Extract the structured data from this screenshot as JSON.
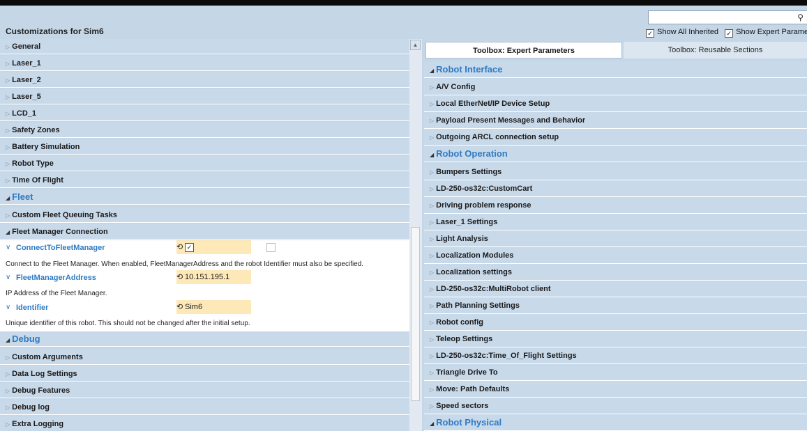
{
  "header": {
    "title": "Customizations for Sim6",
    "search_placeholder": "",
    "show_all_inherited": "Show All Inherited",
    "show_expert": "Show Expert Paramet"
  },
  "left": {
    "top_items": [
      "General",
      "Laser_1",
      "Laser_2",
      "Laser_5",
      "LCD_1",
      "Safety Zones",
      "Battery Simulation",
      "Robot Type",
      "Time Of Flight"
    ],
    "fleet_section": "Fleet",
    "fleet_items": [
      "Custom Fleet Queuing Tasks"
    ],
    "fmc_group": "Fleet Manager Connection",
    "params": [
      {
        "name": "ConnectToFleetManager",
        "value": "",
        "desc": "Connect to the Fleet Manager. When enabled, FleetManagerAddress and the robot Identifier must also be specified."
      },
      {
        "name": "FleetManagerAddress",
        "value": "10.151.195.1",
        "desc": "IP Address of the Fleet Manager."
      },
      {
        "name": "Identifier",
        "value": "Sim6",
        "desc": "Unique identifier of this robot. This should not be changed after the initial setup."
      }
    ],
    "debug_section": "Debug",
    "debug_items": [
      "Custom Arguments",
      "Data Log Settings",
      "Debug Features",
      "Debug log",
      "Extra Logging"
    ]
  },
  "right": {
    "tabs": [
      "Toolbox: Expert Parameters",
      "Toolbox: Reusable Sections"
    ],
    "sections": [
      {
        "title": "Robot Interface",
        "items": [
          "A/V Config",
          "Local EtherNet/IP Device Setup",
          "Payload Present Messages and Behavior",
          "Outgoing ARCL connection setup"
        ]
      },
      {
        "title": "Robot Operation",
        "items": [
          "Bumpers Settings",
          "LD-250-os32c:CustomCart",
          "Driving problem response",
          "Laser_1 Settings",
          "Light Analysis",
          "Localization Modules",
          "Localization settings",
          "LD-250-os32c:MultiRobot client",
          "Path Planning Settings",
          "Robot config",
          "Teleop Settings",
          "LD-250-os32c:Time_Of_Flight Settings",
          "Triangle Drive To",
          "Move: Path Defaults",
          "Speed sectors"
        ]
      },
      {
        "title": "Robot Physical",
        "items": []
      }
    ]
  },
  "colors": {
    "accent": "#2e7bc4",
    "row_bg": "#c8d9ea",
    "value_bg": "#fde8b8"
  }
}
